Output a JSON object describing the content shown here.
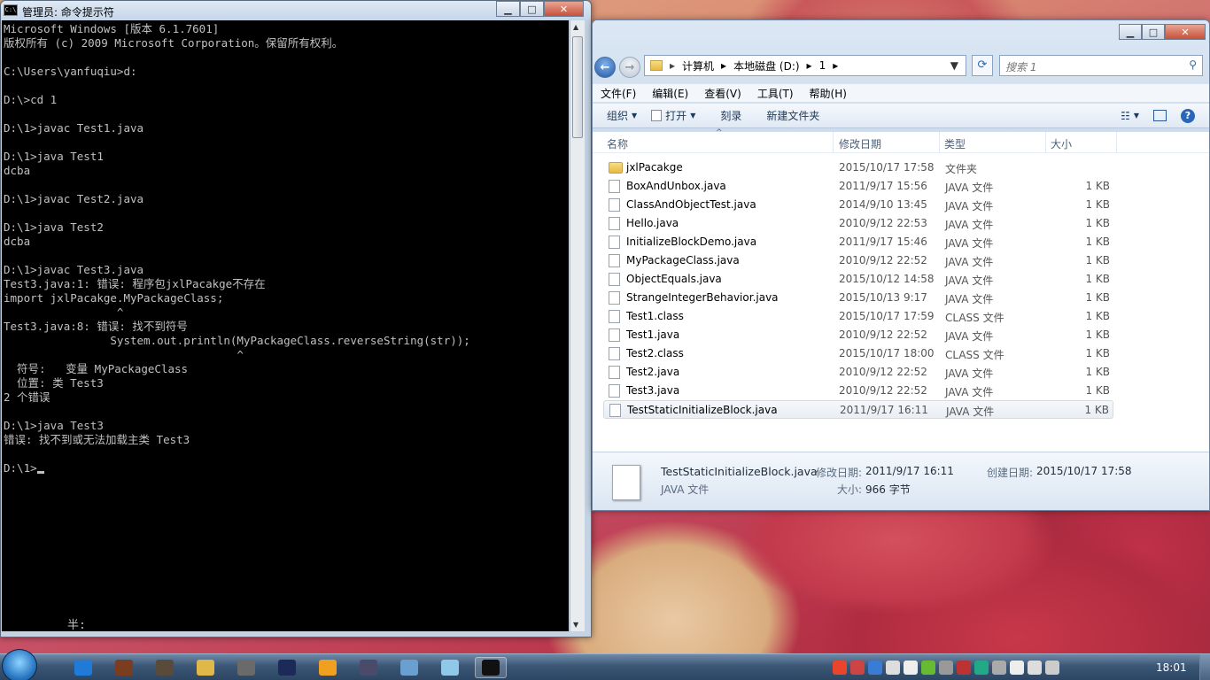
{
  "cmd": {
    "title": "管理员: 命令提示符",
    "icon_label": "C:\\",
    "lines": [
      "Microsoft Windows [版本 6.1.7601]",
      "版权所有 (c) 2009 Microsoft Corporation。保留所有权利。",
      "",
      "C:\\Users\\yanfuqiu>d:",
      "",
      "D:\\>cd 1",
      "",
      "D:\\1>javac Test1.java",
      "",
      "D:\\1>java Test1",
      "dcba",
      "",
      "D:\\1>javac Test2.java",
      "",
      "D:\\1>java Test2",
      "dcba",
      "",
      "D:\\1>javac Test3.java",
      "Test3.java:1: 错误: 程序包jxlPacakge不存在",
      "import jxlPacakge.MyPackageClass;",
      "                 ^",
      "Test3.java:8: 错误: 找不到符号",
      "                System.out.println(MyPackageClass.reverseString(str));",
      "                                   ^",
      "  符号:   变量 MyPackageClass",
      "  位置: 类 Test3",
      "2 个错误",
      "",
      "D:\\1>java Test3",
      "错误: 找不到或无法加载主类 Test3",
      "",
      "D:\\1>"
    ],
    "ime_text": "半:"
  },
  "explorer": {
    "address": [
      "计算机",
      "本地磁盘 (D:)",
      "1"
    ],
    "search_placeholder": "搜索 1",
    "menu": [
      "文件(F)",
      "编辑(E)",
      "查看(V)",
      "工具(T)",
      "帮助(H)"
    ],
    "toolbar": {
      "organize": "组织",
      "open": "打开",
      "burn": "刻录",
      "new_folder": "新建文件夹"
    },
    "columns": {
      "name": "名称",
      "date": "修改日期",
      "type": "类型",
      "size": "大小"
    },
    "files": [
      {
        "name": "jxlPacakge",
        "date": "2015/10/17 17:58",
        "type": "文件夹",
        "size": "",
        "kind": "folder"
      },
      {
        "name": "BoxAndUnbox.java",
        "date": "2011/9/17 15:56",
        "type": "JAVA 文件",
        "size": "1 KB",
        "kind": "file"
      },
      {
        "name": "ClassAndObjectTest.java",
        "date": "2014/9/10 13:45",
        "type": "JAVA 文件",
        "size": "1 KB",
        "kind": "file"
      },
      {
        "name": "Hello.java",
        "date": "2010/9/12 22:53",
        "type": "JAVA 文件",
        "size": "1 KB",
        "kind": "file"
      },
      {
        "name": "InitializeBlockDemo.java",
        "date": "2011/9/17 15:46",
        "type": "JAVA 文件",
        "size": "1 KB",
        "kind": "file"
      },
      {
        "name": "MyPackageClass.java",
        "date": "2010/9/12 22:52",
        "type": "JAVA 文件",
        "size": "1 KB",
        "kind": "file"
      },
      {
        "name": "ObjectEquals.java",
        "date": "2015/10/12 14:58",
        "type": "JAVA 文件",
        "size": "1 KB",
        "kind": "file"
      },
      {
        "name": "StrangeIntegerBehavior.java",
        "date": "2015/10/13 9:17",
        "type": "JAVA 文件",
        "size": "1 KB",
        "kind": "file"
      },
      {
        "name": "Test1.class",
        "date": "2015/10/17 17:59",
        "type": "CLASS 文件",
        "size": "1 KB",
        "kind": "file"
      },
      {
        "name": "Test1.java",
        "date": "2010/9/12 22:52",
        "type": "JAVA 文件",
        "size": "1 KB",
        "kind": "file"
      },
      {
        "name": "Test2.class",
        "date": "2015/10/17 18:00",
        "type": "CLASS 文件",
        "size": "1 KB",
        "kind": "file"
      },
      {
        "name": "Test2.java",
        "date": "2010/9/12 22:52",
        "type": "JAVA 文件",
        "size": "1 KB",
        "kind": "file"
      },
      {
        "name": "Test3.java",
        "date": "2010/9/12 22:52",
        "type": "JAVA 文件",
        "size": "1 KB",
        "kind": "file"
      },
      {
        "name": "TestStaticInitializeBlock.java",
        "date": "2011/9/17 16:11",
        "type": "JAVA 文件",
        "size": "1 KB",
        "kind": "file",
        "selected": true
      }
    ],
    "details": {
      "name": "TestStaticInitializeBlock.java",
      "type": "JAVA 文件",
      "modified_label": "修改日期:",
      "modified": "2011/9/17 16:11",
      "size_label": "大小:",
      "size": "966 字节",
      "created_label": "创建日期:",
      "created": "2015/10/17 17:58"
    }
  },
  "taskbar": {
    "clock": "18:01",
    "pinned_icons": [
      "ie-icon",
      "game-icon",
      "game2-icon",
      "folder-icon",
      "app-icon",
      "lol-icon",
      "powerpoint-icon",
      "settings-icon",
      "tool-icon",
      "notepad-icon",
      "cmd-icon"
    ],
    "tray_icons": [
      "sogou-icon",
      "qq-icon",
      "shield-icon",
      "volume-icon",
      "windows-icon",
      "nvidia-icon",
      "monitor-icon",
      "antivirus-icon",
      "bird-icon",
      "pc-icon",
      "flag-icon",
      "speaker-icon",
      "network-icon"
    ]
  }
}
